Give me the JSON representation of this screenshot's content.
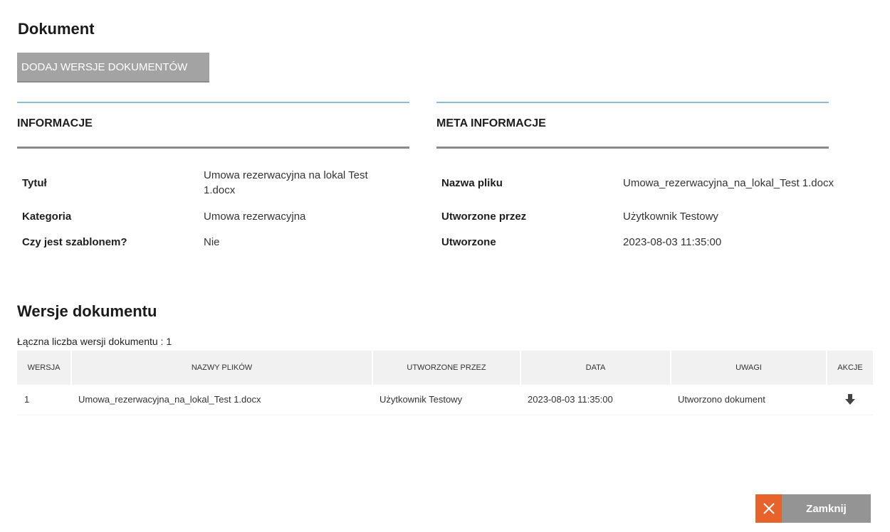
{
  "page": {
    "title": "Dokument"
  },
  "actions": {
    "add_versions_label": "DODAJ WERSJE DOKUMENTÓW",
    "close_label": "Zamknij"
  },
  "info": {
    "heading": "INFORMACJE",
    "rows": [
      {
        "label": "Tytuł",
        "value": "Umowa rezerwacyjna na lokal Test 1.docx"
      },
      {
        "label": "Kategoria",
        "value": "Umowa rezerwacyjna"
      },
      {
        "label": "Czy jest szablonem?",
        "value": "Nie"
      }
    ]
  },
  "meta": {
    "heading": "META INFORMACJE",
    "rows": [
      {
        "label": "Nazwa pliku",
        "value": "Umowa_rezerwacyjna_na_lokal_Test 1.docx"
      },
      {
        "label": "Utworzone przez",
        "value": "Użytkownik Testowy"
      },
      {
        "label": "Utworzone",
        "value": "2023-08-03 11:35:00"
      }
    ]
  },
  "versions": {
    "title": "Wersje dokumentu",
    "count_text": "Łączna liczba wersji dokumentu : 1",
    "columns": [
      "WERSJA",
      "NAZWY PLIKÓW",
      "UTWORZONE PRZEZ",
      "DATA",
      "UWAGI",
      "AKCJE"
    ],
    "rows": [
      {
        "version": "1",
        "file": "Umowa_rezerwacyjna_na_lokal_Test 1.docx",
        "created_by": "Użytkownik Testowy",
        "date": "2023-08-03 11:35:00",
        "notes": "Utworzono dokument",
        "action_icon": "download-arrow-icon"
      }
    ]
  },
  "colors": {
    "accent_line": "#8cbcd8",
    "close_icon_bg": "#e8622c",
    "button_gray": "#a3a3a3"
  }
}
